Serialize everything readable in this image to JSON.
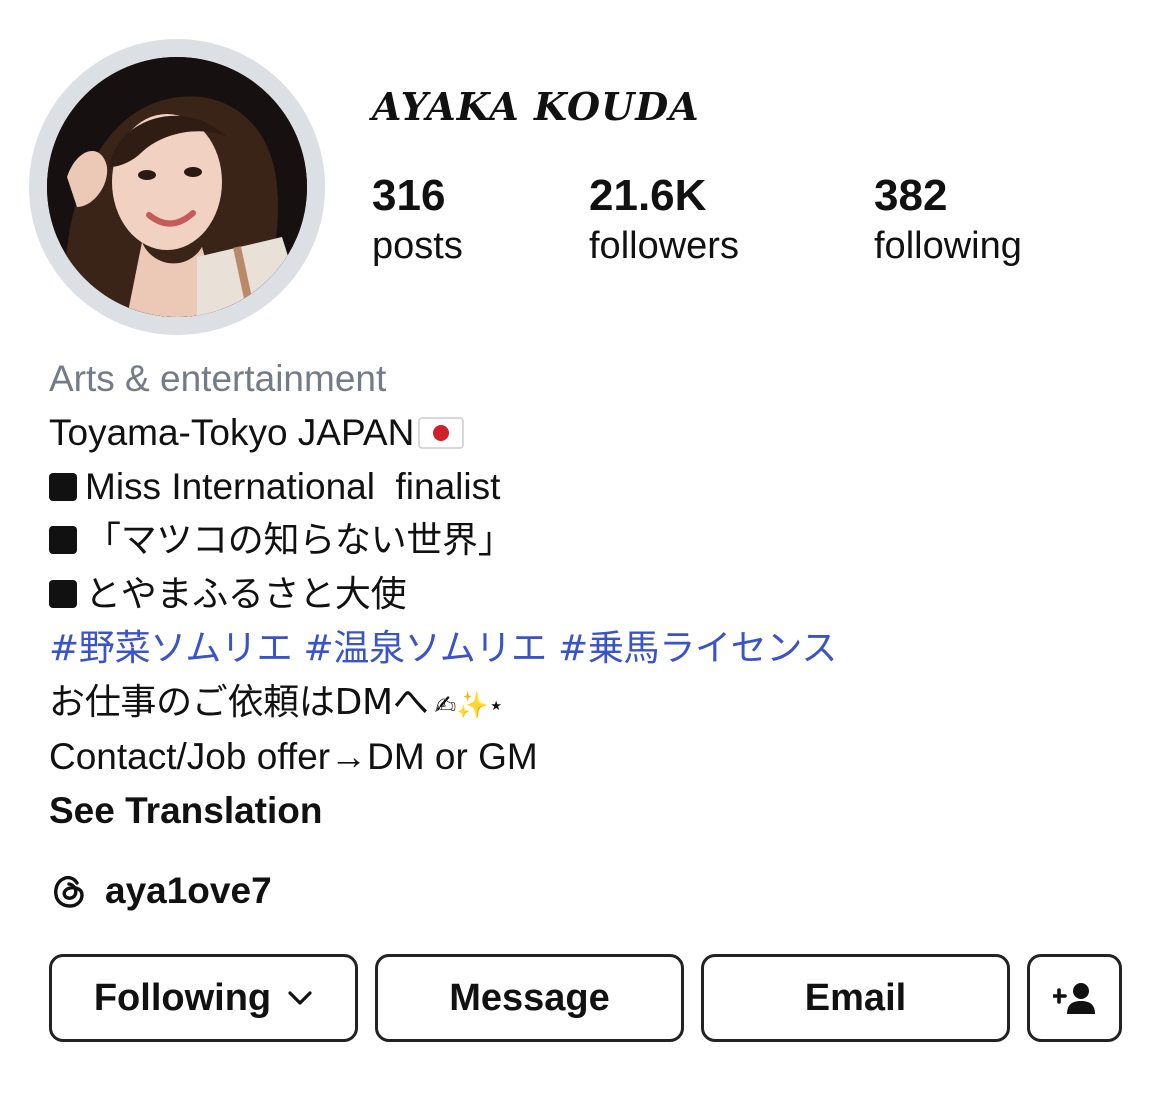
{
  "profile": {
    "display_name": "AYAKA KOUDA",
    "avatar_icon": "profile-photo"
  },
  "stats": {
    "posts": {
      "value": "316",
      "label": "posts"
    },
    "followers": {
      "value": "21.6K",
      "label": "followers"
    },
    "following": {
      "value": "382",
      "label": "following"
    }
  },
  "bio": {
    "category": "Arts & entertainment",
    "location": "Toyama-Tokyo JAPAN",
    "location_flag": "japan-flag-icon",
    "item1": "Miss International  finalist",
    "item2": "「マツコの知らない世界」",
    "item3": "とやまふるさと大使",
    "hashtags": "#野菜ソムリエ #温泉ソムリエ #乗馬ライセンス",
    "work_request": "お仕事のご依頼はDMへ",
    "work_request_decor": "✍︎✨⋆",
    "contact": "Contact/Job offer→DM or GM",
    "see_translation": "See Translation"
  },
  "threads": {
    "icon": "threads-icon",
    "handle": "aya1ove7"
  },
  "buttons": {
    "following": "Following",
    "message": "Message",
    "email": "Email",
    "add_user_icon": "add-user-icon"
  },
  "colors": {
    "hashtag": "#3a53c8",
    "category": "#737b86",
    "ring": "#dcdfe4",
    "border": "#222222"
  }
}
